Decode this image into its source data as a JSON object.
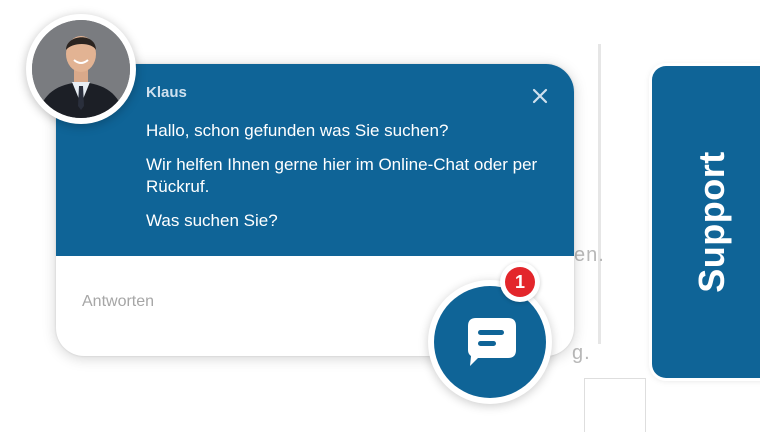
{
  "chat": {
    "agent_name": "Klaus",
    "messages": [
      "Hallo, schon gefunden was Sie suchen?",
      "Wir helfen Ihnen gerne hier im Online-Chat oder per Rückruf.",
      "Was suchen Sie?"
    ],
    "reply_placeholder": "Antworten",
    "unread_count": "1"
  },
  "background": {
    "fragment_1": "en.",
    "fragment_2": "g."
  },
  "support_tab": {
    "label": "Support"
  },
  "colors": {
    "primary": "#0f6497",
    "badge": "#e3262b",
    "white": "#ffffff"
  },
  "icons": {
    "close": "close-icon",
    "chat": "chat-bubble-icon",
    "avatar": "agent-avatar"
  }
}
